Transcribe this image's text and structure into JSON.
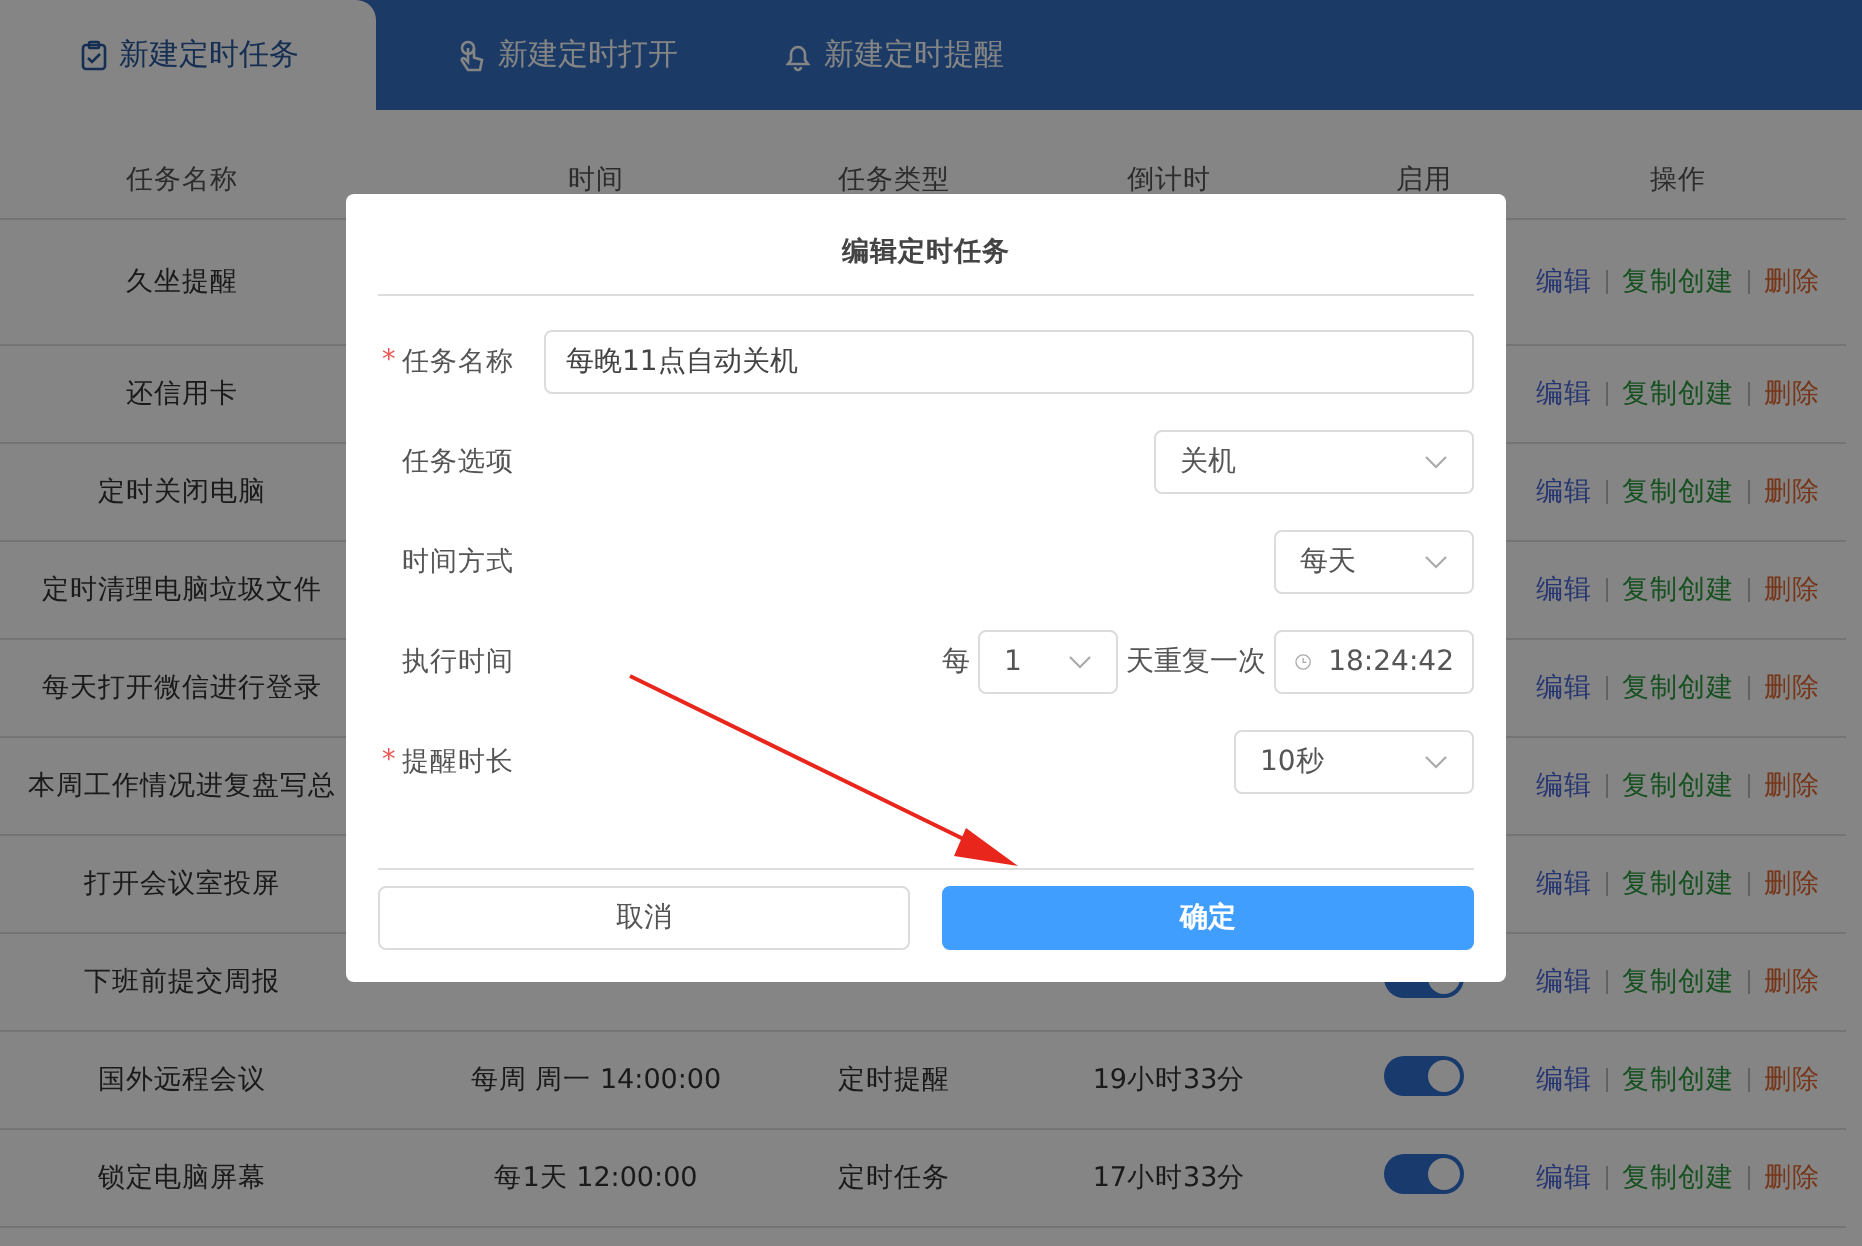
{
  "tabs": [
    {
      "label": "新建定时任务",
      "selected": true
    },
    {
      "label": "新建定时打开",
      "selected": false
    },
    {
      "label": "新建定时提醒",
      "selected": false
    }
  ],
  "table": {
    "columns": [
      "任务名称",
      "时间",
      "任务类型",
      "倒计时",
      "启用",
      "操作"
    ],
    "rows": [
      {
        "name": "久坐提醒",
        "actions": [
          {
            "kind": "edit",
            "label": "编辑"
          },
          {
            "kind": "copy",
            "label": "复制创建"
          },
          {
            "kind": "delete",
            "label": "删除"
          }
        ]
      },
      {
        "name": "还信用卡",
        "actions": [
          {
            "kind": "edit",
            "label": "编辑"
          },
          {
            "kind": "copy",
            "label": "复制创建"
          },
          {
            "kind": "delete",
            "label": "删除"
          }
        ]
      },
      {
        "name": "定时关闭电脑",
        "actions": [
          {
            "kind": "edit",
            "label": "编辑"
          },
          {
            "kind": "copy",
            "label": "复制创建"
          },
          {
            "kind": "delete",
            "label": "删除"
          }
        ]
      },
      {
        "name": "定时清理电脑垃圾文件",
        "actions": [
          {
            "kind": "edit",
            "label": "编辑"
          },
          {
            "kind": "copy",
            "label": "复制创建"
          },
          {
            "kind": "delete",
            "label": "删除"
          }
        ]
      },
      {
        "name": "每天打开微信进行登录",
        "actions": [
          {
            "kind": "edit",
            "label": "编辑"
          },
          {
            "kind": "copy",
            "label": "复制创建"
          },
          {
            "kind": "delete",
            "label": "删除"
          }
        ]
      },
      {
        "name": "本周工作情况进复盘写总",
        "actions": [
          {
            "kind": "edit",
            "label": "编辑"
          },
          {
            "kind": "copy",
            "label": "复制创建"
          },
          {
            "kind": "delete",
            "label": "删除"
          }
        ]
      },
      {
        "name": "打开会议室投屏",
        "actions": [
          {
            "kind": "edit",
            "label": "编辑"
          },
          {
            "kind": "copy",
            "label": "复制创建"
          },
          {
            "kind": "delete",
            "label": "删除"
          }
        ]
      },
      {
        "name": "下班前提交周报",
        "enabled": true,
        "actions": [
          {
            "kind": "edit",
            "label": "编辑"
          },
          {
            "kind": "copy",
            "label": "复制创建"
          },
          {
            "kind": "delete",
            "label": "删除"
          }
        ]
      },
      {
        "name": "国外远程会议",
        "time": "每周 周一 14:00:00",
        "type": "定时提醒",
        "countdown": "19小时33分",
        "enabled": true,
        "actions": [
          {
            "kind": "edit",
            "label": "编辑"
          },
          {
            "kind": "copy",
            "label": "复制创建"
          },
          {
            "kind": "delete",
            "label": "删除"
          }
        ]
      },
      {
        "name": "锁定电脑屏幕",
        "time": "每1天 12:00:00",
        "type": "定时任务",
        "countdown": "17小时33分",
        "enabled": true,
        "actions": [
          {
            "kind": "edit",
            "label": "编辑"
          },
          {
            "kind": "copy",
            "label": "复制创建"
          },
          {
            "kind": "delete",
            "label": "删除"
          }
        ]
      }
    ]
  },
  "dialog": {
    "title": "编辑定时任务",
    "fields": [
      {
        "kind": "text",
        "mark": "*",
        "label": "任务名称",
        "value": "每晚11点自动关机"
      },
      {
        "kind": "select",
        "label": "任务选项",
        "value": "关机"
      },
      {
        "kind": "select",
        "label": "时间方式",
        "value": "每天"
      },
      {
        "kind": "schedule",
        "label": "执行时间",
        "prefix": "每",
        "interval": "1",
        "suffix": "天重复一次",
        "time": "18:24:42"
      },
      {
        "kind": "select",
        "mark": "*",
        "label": "提醒时长",
        "value": "10秒"
      }
    ],
    "buttons": [
      {
        "kind": "secondary",
        "label": "取消"
      },
      {
        "kind": "primary",
        "label": "确定"
      }
    ]
  }
}
